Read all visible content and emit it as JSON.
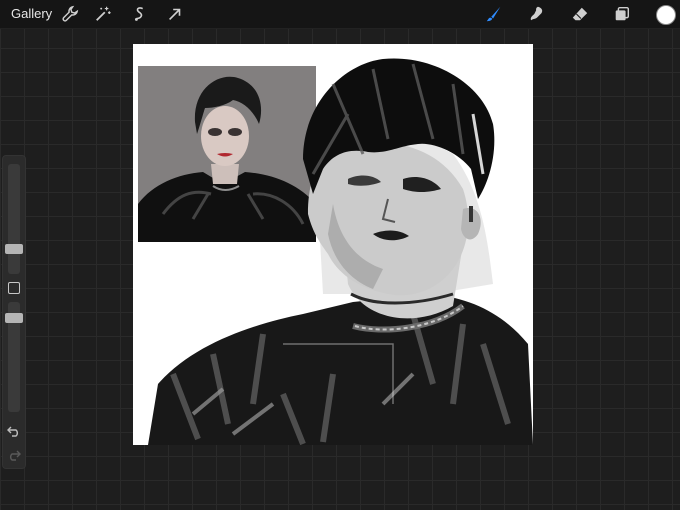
{
  "topbar": {
    "gallery_label": "Gallery",
    "tools_left": [
      {
        "icon": "wrench-icon"
      },
      {
        "icon": "magic-wand-icon"
      },
      {
        "icon": "selection-icon"
      },
      {
        "icon": "transform-arrow-icon"
      }
    ],
    "tools_right": [
      {
        "icon": "brush-icon",
        "active": true,
        "color": "#2f8cff"
      },
      {
        "icon": "smudge-icon"
      },
      {
        "icon": "eraser-icon"
      },
      {
        "icon": "layers-icon"
      }
    ],
    "current_color": "#ffffff"
  },
  "sidebar": {
    "brush_size_level": 0.74,
    "opacity_level": 0.7,
    "buttons": [
      "modify-icon",
      "undo-icon",
      "redo-icon"
    ]
  },
  "canvas": {
    "background": "#ffffff",
    "content": [
      "reference-photo",
      "grayscale-portrait-painting"
    ]
  }
}
